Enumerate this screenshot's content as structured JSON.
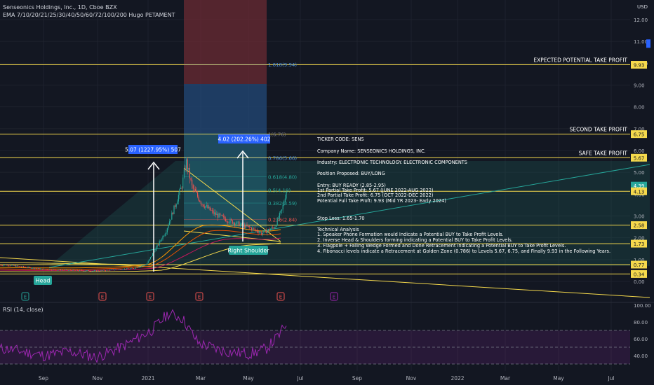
{
  "header": {
    "symbol_title": "Senseonics Holdings, Inc., 1D, Cboe BZX",
    "ema_legend": "EMA 7/10/20/21/25/30/40/50/60/72/100/200 Hugo PETAMENT",
    "currency": "USD"
  },
  "price_axis": {
    "ticks": [
      "12.00",
      "11.00",
      "10.00",
      "9.00",
      "8.00",
      "7.00",
      "6.00",
      "5.00",
      "4.00",
      "3.00",
      "2.00",
      "1.00",
      "0.00"
    ],
    "ylim": [
      0,
      12.6
    ]
  },
  "time_axis": {
    "ticks": [
      "Sep",
      "Nov",
      "2021",
      "Mar",
      "May",
      "Jul",
      "Sep",
      "Nov",
      "2022",
      "Mar",
      "May",
      "Jul"
    ]
  },
  "price_labels": [
    {
      "text": "9.93",
      "value": 9.93,
      "color": "#f5d94c",
      "dark": true
    },
    {
      "text": "6.75",
      "value": 6.75,
      "color": "#f5d94c",
      "dark": true
    },
    {
      "text": "5.67",
      "value": 5.67,
      "color": "#f5d94c",
      "dark": true
    },
    {
      "text": "4.39",
      "value": 4.39,
      "color": "#26a69a",
      "dark": false
    },
    {
      "text": "4.13",
      "value": 4.13,
      "color": "#f5d94c",
      "dark": true
    },
    {
      "text": "2.58",
      "value": 2.58,
      "color": "#f5d94c",
      "dark": true
    },
    {
      "text": "1.73",
      "value": 1.73,
      "color": "#f5d94c",
      "dark": true
    },
    {
      "text": "0.77",
      "value": 0.77,
      "color": "#f5d94c",
      "dark": true
    },
    {
      "text": "0.34",
      "value": 0.34,
      "color": "#f5d94c",
      "dark": true
    }
  ],
  "horizontal_levels": [
    {
      "value": 9.93,
      "label": "EXPECTED POTENTIAL TAKE PROFIT"
    },
    {
      "value": 6.75,
      "label": "SECOND TAKE PROFIT"
    },
    {
      "value": 5.67,
      "label": "SAFE TAKE PROFIT"
    },
    {
      "value": 4.13,
      "label": ""
    },
    {
      "value": 2.58,
      "label": ""
    },
    {
      "value": 1.73,
      "label": ""
    },
    {
      "value": 0.77,
      "label": ""
    },
    {
      "value": 0.34,
      "label": ""
    }
  ],
  "fibonacci": [
    {
      "text": "1.618(9.94)",
      "value": 9.94,
      "color": "#4a90d9"
    },
    {
      "text": "1(6.76)",
      "value": 6.76,
      "color": "#787b86"
    },
    {
      "text": "0.786(5.66)",
      "value": 5.66,
      "color": "#4a90d9"
    },
    {
      "text": "0.618(4.80)",
      "value": 4.8,
      "color": "#26a69a"
    },
    {
      "text": "0.5(4.19)",
      "value": 4.19,
      "color": "#26a69a"
    },
    {
      "text": "0.382(3.59)",
      "value": 3.59,
      "color": "#26a69a"
    },
    {
      "text": "0.236(2.84)",
      "value": 2.84,
      "color": "#ef5350"
    }
  ],
  "measure_labels": [
    {
      "text": "5.07 (1227.95%) 507"
    },
    {
      "text": "4.02 (202.26%) 402"
    }
  ],
  "pattern_labels": {
    "head": "Head",
    "right_shoulder": "Right Shoulder"
  },
  "event_flags": [
    "E",
    "E",
    "E",
    "E",
    "E",
    "E"
  ],
  "analysis_text": [
    "TICKER CODE: SENS",
    "Company Name: SENSEONICS HOLDINGS, INC.",
    "Industry: ELECTRONIC TECHNOLOGY. ELECTRONIC COMPONENTS",
    "Position Proposed: BUY/LONG",
    "Entry: BUY READY (2.85-2.95)",
    "1st Partial Take Profit: 5.67 (JUNE 2022-AUG 2022)",
    "2nd Partial Take Profit: 6.75 (OCT 2022-DEC 2022)",
    "Potential Full Take Proft: 9.93 (Mid YR 2023- Early 2024)",
    "Stop Loss: 1.65-1.70",
    "Technical Analysis",
    "1. Speaker Phone Formation would Indicate a Potential BUY to Take Profit Levels.",
    "2. Inverse Head & Shoulders forming indicating a Potential BUY to Take Profit Levels.",
    "3. Flagpole + Falling Wedge Formed and Done Retracement indicating a Potential BUY to Take Profit Levels.",
    "4. Fibonacci levels indicate a Retracement at Golden Zone (0.786) to Levels 5.67, 6.75, and Finally 9.93 in the Following Years."
  ],
  "rsi": {
    "label": "RSI (14, close)",
    "ticks": [
      "100.00",
      "80.00",
      "60.00",
      "40.00"
    ],
    "ylim": [
      26,
      104
    ],
    "band": [
      30,
      70
    ],
    "midline": 50
  },
  "colors": {
    "background": "#131722",
    "grid": "#1e222d",
    "level": "#f5d94c",
    "up": "#26a69a",
    "down": "#ef5350",
    "rsi": "#9c27b0",
    "axis_text": "#b2b5be"
  },
  "chart_data": {
    "type": "candlestick",
    "x_ticks": [
      "Sep",
      "Nov",
      "2021",
      "Mar",
      "May",
      "Jul",
      "Sep",
      "Nov",
      "2022",
      "Mar",
      "May",
      "Jul"
    ],
    "ylim": [
      0,
      12.6
    ],
    "price_path": [
      {
        "date": "2020-07-20",
        "close": 0.75
      },
      {
        "date": "2020-09-01",
        "close": 0.55
      },
      {
        "date": "2020-11-01",
        "close": 0.48
      },
      {
        "date": "2020-12-15",
        "close": 0.6
      },
      {
        "date": "2020-12-30",
        "close": 0.77
      },
      {
        "date": "2021-01-10",
        "close": 1.5
      },
      {
        "date": "2021-01-22",
        "close": 2.3
      },
      {
        "date": "2021-02-02",
        "close": 3.5
      },
      {
        "date": "2021-02-10",
        "close": 4.4
      },
      {
        "date": "2021-02-15",
        "close": 5.5
      },
      {
        "date": "2021-02-22",
        "close": 4.3
      },
      {
        "date": "2021-03-05",
        "close": 3.6
      },
      {
        "date": "2021-03-20",
        "close": 3.1
      },
      {
        "date": "2021-04-05",
        "close": 2.8
      },
      {
        "date": "2021-04-20",
        "close": 2.6
      },
      {
        "date": "2021-05-05",
        "close": 2.4
      },
      {
        "date": "2021-05-15",
        "close": 2.2
      },
      {
        "date": "2021-05-30",
        "close": 2.5
      },
      {
        "date": "2021-06-08",
        "close": 3.3
      },
      {
        "date": "2021-06-14",
        "close": 4.39
      }
    ],
    "rsi_path": [
      {
        "date": "2020-07-20",
        "value": 48
      },
      {
        "date": "2020-09-01",
        "value": 40
      },
      {
        "date": "2020-10-01",
        "value": 45
      },
      {
        "date": "2020-11-01",
        "value": 38
      },
      {
        "date": "2020-12-01",
        "value": 50
      },
      {
        "date": "2021-01-05",
        "value": 70
      },
      {
        "date": "2021-01-25",
        "value": 90
      },
      {
        "date": "2021-02-10",
        "value": 85
      },
      {
        "date": "2021-03-01",
        "value": 55
      },
      {
        "date": "2021-04-01",
        "value": 45
      },
      {
        "date": "2021-05-01",
        "value": 42
      },
      {
        "date": "2021-05-20",
        "value": 48
      },
      {
        "date": "2021-06-05",
        "value": 65
      },
      {
        "date": "2021-06-14",
        "value": 80
      }
    ]
  }
}
